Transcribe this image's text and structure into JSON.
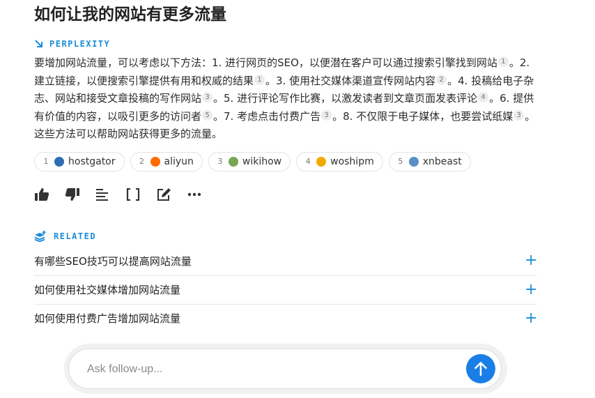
{
  "title": "如何让我的网站有更多流量",
  "source_header": "PERPLEXITY",
  "answer": {
    "segments": [
      {
        "text": "要增加网站流量，可以考虑以下方法：1. 进行网页的SEO，以便潜在客户可以通过搜索引擎找到网站",
        "cite": "1"
      },
      {
        "text": "。2. 建立链接，以便搜索引擎提供有用和权威的结果",
        "cite": "1"
      },
      {
        "text": "。3. 使用社交媒体渠道宣传网站内容",
        "cite": "2"
      },
      {
        "text": "。4. 投稿给电子杂志、网站和接受文章投稿的写作网站",
        "cite": "3"
      },
      {
        "text": "。5. 进行评论写作比赛，以激发读者到文章页面发表评论",
        "cite": "4"
      },
      {
        "text": "。6. 提供有价值的内容，以吸引更多的访问者",
        "cite": "5"
      },
      {
        "text": "。7. 考虑点击付费广告",
        "cite": "3"
      },
      {
        "text": "。8. 不仅限于电子媒体，也要尝试纸媒",
        "cite": "3"
      },
      {
        "text": "。这些方法可以帮助网站获得更多的流量。",
        "cite": ""
      }
    ]
  },
  "sources": [
    {
      "num": "1",
      "name": "hostgator",
      "icon": "hostgator-favicon",
      "color": "#2f6db5"
    },
    {
      "num": "2",
      "name": "aliyun",
      "icon": "aliyun-favicon",
      "color": "#ff6a00"
    },
    {
      "num": "3",
      "name": "wikihow",
      "icon": "wikihow-favicon",
      "color": "#7aa554"
    },
    {
      "num": "4",
      "name": "woshipm",
      "icon": "woshipm-favicon",
      "color": "#f2a900"
    },
    {
      "num": "5",
      "name": "xnbeast",
      "icon": "xnbeast-favicon",
      "color": "#5a8fc4"
    }
  ],
  "actions": [
    "thumbs-up-icon",
    "thumbs-down-icon",
    "rewrite-lines-icon",
    "expand-brackets-icon",
    "edit-icon",
    "more-icon"
  ],
  "related_header": "RELATED",
  "related": [
    "有哪些SEO技巧可以提高网站流量",
    "如何使用社交媒体增加网站流量",
    "如何使用付费广告增加网站流量"
  ],
  "followup": {
    "placeholder": "Ask follow-up...",
    "value": ""
  },
  "colors": {
    "accent": "#1a8cd8",
    "send_button": "#1a7ee6"
  }
}
